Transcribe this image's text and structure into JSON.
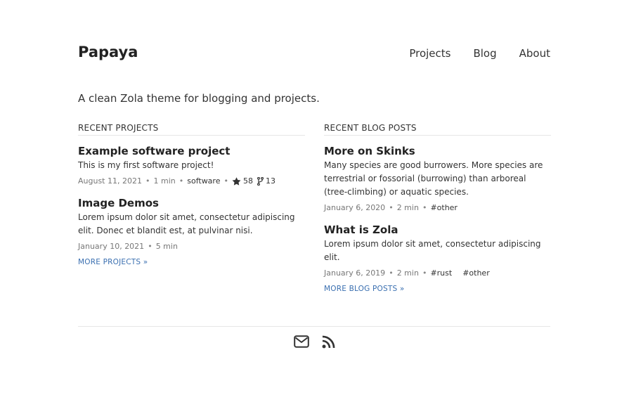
{
  "site": {
    "title": "Papaya",
    "tagline": "A clean Zola theme for blogging and projects."
  },
  "nav": {
    "items": [
      {
        "label": "Projects"
      },
      {
        "label": "Blog"
      },
      {
        "label": "About"
      }
    ]
  },
  "projects": {
    "header": "Recent projects",
    "items": [
      {
        "title": "Example software project",
        "description": "This is my first software project!",
        "date": "August 11, 2021",
        "read_time": "1 min",
        "tag": "software",
        "stars": "58",
        "forks": "13"
      },
      {
        "title": "Image Demos",
        "description": "Lorem ipsum dolor sit amet, consectetur adipiscing elit. Donec et blandit est, at pulvinar nisi.",
        "date": "January 10, 2021",
        "read_time": "5 min"
      }
    ],
    "more_label": "More projects »"
  },
  "blog": {
    "header": "Recent blog posts",
    "items": [
      {
        "title": "More on Skinks",
        "description": "Many species are good burrowers. More species are terrestrial or fossorial (burrowing) than arboreal (tree-climbing) or aquatic species.",
        "date": "January 6, 2020",
        "read_time": "2 min",
        "tags": [
          "#other"
        ]
      },
      {
        "title": "What is Zola",
        "description": "Lorem ipsum dolor sit amet, consectetur adipiscing elit.",
        "date": "January 6, 2019",
        "read_time": "2 min",
        "tags": [
          "#rust",
          "#other"
        ]
      }
    ],
    "more_label": "More blog posts »"
  },
  "footer": {
    "icons": [
      "mail-icon",
      "rss-icon"
    ]
  },
  "colors": {
    "text": "#222222",
    "muted": "#777777",
    "link": "#3a6fb0",
    "divider": "#e6e6e6"
  }
}
